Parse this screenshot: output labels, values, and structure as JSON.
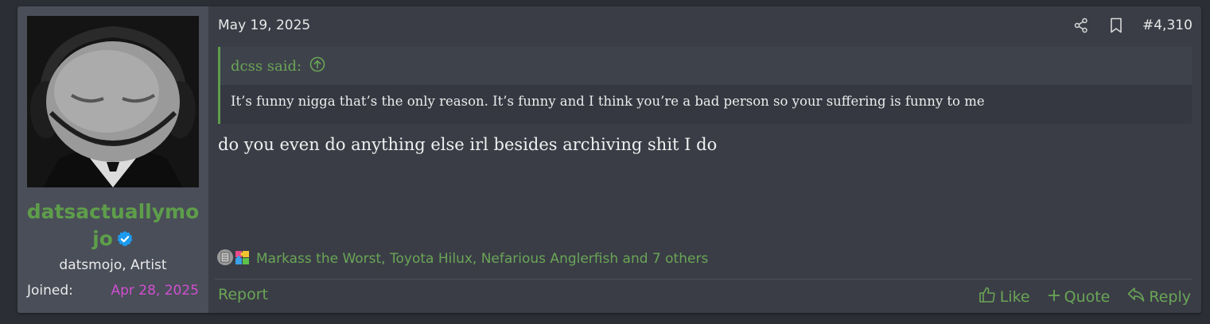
{
  "post": {
    "date": "May 19, 2025",
    "number": "#4,310",
    "message": "do you even do anything else irl besides archiving shit I do"
  },
  "user": {
    "name_line1": "datsactuallymo",
    "name_line2": "jo",
    "title": "datsmojo, Artist",
    "joined_label": "Joined:",
    "joined_date": "Apr 28, 2025"
  },
  "quote": {
    "author": "dcss said:",
    "text": "It’s funny nigga that’s the only reason. It’s funny and I think you’re a bad person so your suffering is funny to me"
  },
  "reactions": {
    "text": "Markass the Worst, Toyota Hilux, Nefarious Anglerfish and 7 others"
  },
  "actions": {
    "report": "Report",
    "like": "Like",
    "quote": "Quote",
    "reply": "Reply"
  },
  "icons": {
    "share": "share-icon",
    "bookmark": "bookmark-icon",
    "quote_jump": "arrow-up-circle-icon",
    "like": "thumbs-up-icon",
    "quote": "plus-icon",
    "reply": "reply-icon",
    "verified": "verified-badge-icon"
  },
  "colors": {
    "accent_green": "#5e9e4a",
    "joined_date": "#d04fd0",
    "verified_blue": "#1d9bf0"
  }
}
